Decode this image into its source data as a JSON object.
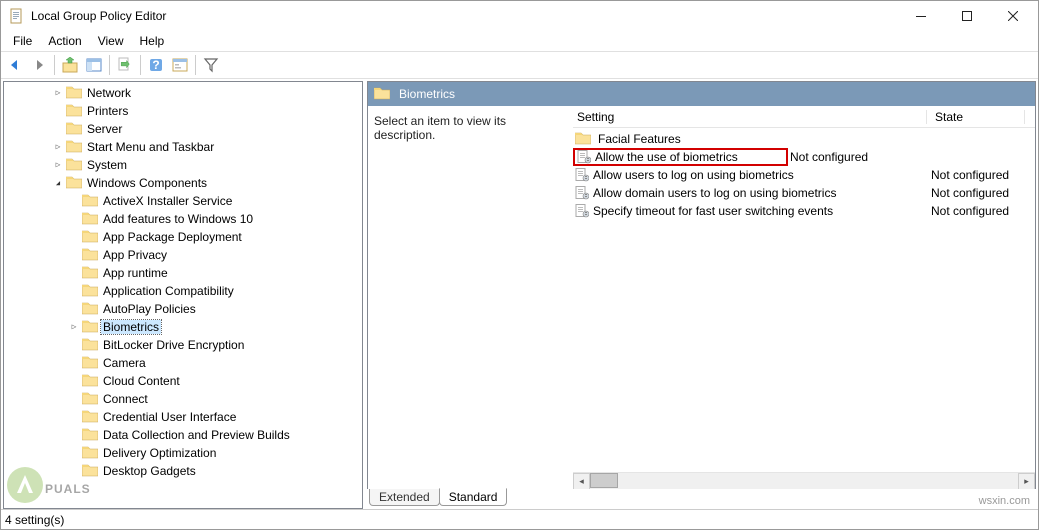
{
  "window": {
    "title": "Local Group Policy Editor"
  },
  "menu": {
    "file": "File",
    "action": "Action",
    "view": "View",
    "help": "Help"
  },
  "tree": {
    "items": [
      {
        "indent": 46,
        "exp": "▶",
        "label": "Network"
      },
      {
        "indent": 46,
        "exp": "",
        "label": "Printers"
      },
      {
        "indent": 46,
        "exp": "",
        "label": "Server"
      },
      {
        "indent": 46,
        "exp": "▶",
        "label": "Start Menu and Taskbar"
      },
      {
        "indent": 46,
        "exp": "▶",
        "label": "System"
      },
      {
        "indent": 46,
        "exp": "▾",
        "label": "Windows Components"
      },
      {
        "indent": 62,
        "exp": "",
        "label": "ActiveX Installer Service"
      },
      {
        "indent": 62,
        "exp": "",
        "label": "Add features to Windows 10"
      },
      {
        "indent": 62,
        "exp": "",
        "label": "App Package Deployment"
      },
      {
        "indent": 62,
        "exp": "",
        "label": "App Privacy"
      },
      {
        "indent": 62,
        "exp": "",
        "label": "App runtime"
      },
      {
        "indent": 62,
        "exp": "",
        "label": "Application Compatibility"
      },
      {
        "indent": 62,
        "exp": "",
        "label": "AutoPlay Policies"
      },
      {
        "indent": 62,
        "exp": "▶",
        "label": "Biometrics",
        "selected": true,
        "highlight": true
      },
      {
        "indent": 62,
        "exp": "",
        "label": "BitLocker Drive Encryption"
      },
      {
        "indent": 62,
        "exp": "",
        "label": "Camera"
      },
      {
        "indent": 62,
        "exp": "",
        "label": "Cloud Content"
      },
      {
        "indent": 62,
        "exp": "",
        "label": "Connect"
      },
      {
        "indent": 62,
        "exp": "",
        "label": "Credential User Interface"
      },
      {
        "indent": 62,
        "exp": "",
        "label": "Data Collection and Preview Builds"
      },
      {
        "indent": 62,
        "exp": "",
        "label": "Delivery Optimization"
      },
      {
        "indent": 62,
        "exp": "",
        "label": "Desktop Gadgets"
      }
    ]
  },
  "content": {
    "header": "Biometrics",
    "desc": "Select an item to view its description.",
    "columns": {
      "setting": "Setting",
      "state": "State"
    },
    "rows": [
      {
        "type": "folder",
        "label": "Facial Features",
        "state": ""
      },
      {
        "type": "policy",
        "label": "Allow the use of biometrics",
        "state": "Not configured",
        "highlight": true
      },
      {
        "type": "policy",
        "label": "Allow users to log on using biometrics",
        "state": "Not configured"
      },
      {
        "type": "policy",
        "label": "Allow domain users to log on using biometrics",
        "state": "Not configured"
      },
      {
        "type": "policy",
        "label": "Specify timeout for fast user switching events",
        "state": "Not configured"
      }
    ],
    "tabs": {
      "extended": "Extended",
      "standard": "Standard"
    }
  },
  "status": {
    "text": "4 setting(s)"
  },
  "watermark": "wsxin.com"
}
